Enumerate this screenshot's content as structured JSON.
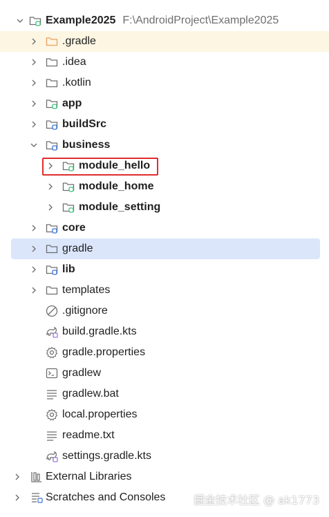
{
  "root": {
    "name": "Example2025",
    "path": "F:\\AndroidProject\\Example2025"
  },
  "items": {
    "gradle_dir": ".gradle",
    "idea": ".idea",
    "kotlin": ".kotlin",
    "app": "app",
    "buildSrc": "buildSrc",
    "business": "business",
    "module_hello": "module_hello",
    "module_home": "module_home",
    "module_setting": "module_setting",
    "core": "core",
    "gradle": "gradle",
    "lib": "lib",
    "templates": "templates",
    "gitignore": ".gitignore",
    "build_gradle_kts": "build.gradle.kts",
    "gradle_properties": "gradle.properties",
    "gradlew": "gradlew",
    "gradlew_bat": "gradlew.bat",
    "local_properties": "local.properties",
    "readme": "readme.txt",
    "settings_gradle_kts": "settings.gradle.kts"
  },
  "external_libraries": "External Libraries",
  "scratches": "Scratches and Consoles",
  "watermark": "掘金技术社区 @ ak1773",
  "colors": {
    "highlight_row": "#fdf6e3",
    "selected_row": "#dbe6fb",
    "annotation_box": "#e02c2c",
    "module_badge": "#3ec07a"
  },
  "state": {
    "selected": "gradle",
    "annotated": "module_hello"
  }
}
